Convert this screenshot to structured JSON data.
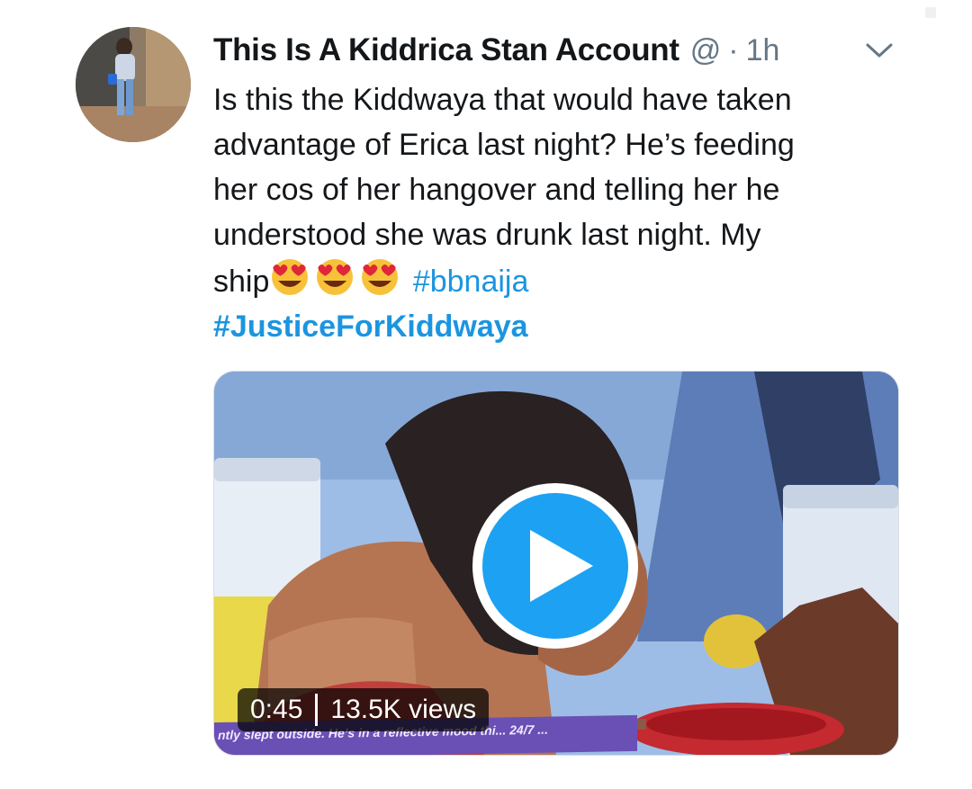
{
  "tweet": {
    "author_name": "This Is A Kiddrica Stan Account",
    "handle": "@",
    "separator": "·",
    "time": "1h",
    "text_lines": [
      "Is this the Kiddwaya that would have taken",
      "advantage of Erica last night? He’s feeding",
      "her cos of her hangover and telling her he",
      "understood she was drunk last night. My"
    ],
    "ship_text": "ship",
    "hashtag_1": "#bbnaija",
    "hashtag_2": "#JusticeForKiddwaya",
    "emojis": [
      "heart-eyes-emoji",
      "heart-eyes-emoji",
      "heart-eyes-emoji"
    ]
  },
  "video": {
    "duration": "0:45",
    "views": "13.5K views",
    "ticker_text": "ntly slept outside. He’s in a reflective mood thi... 24/7 ..."
  },
  "icons": {
    "caret": "chevron-down-icon",
    "play": "play-icon"
  },
  "colors": {
    "link": "#1b95e0",
    "play_button": "#1da1f2",
    "secondary_text": "#657786"
  }
}
